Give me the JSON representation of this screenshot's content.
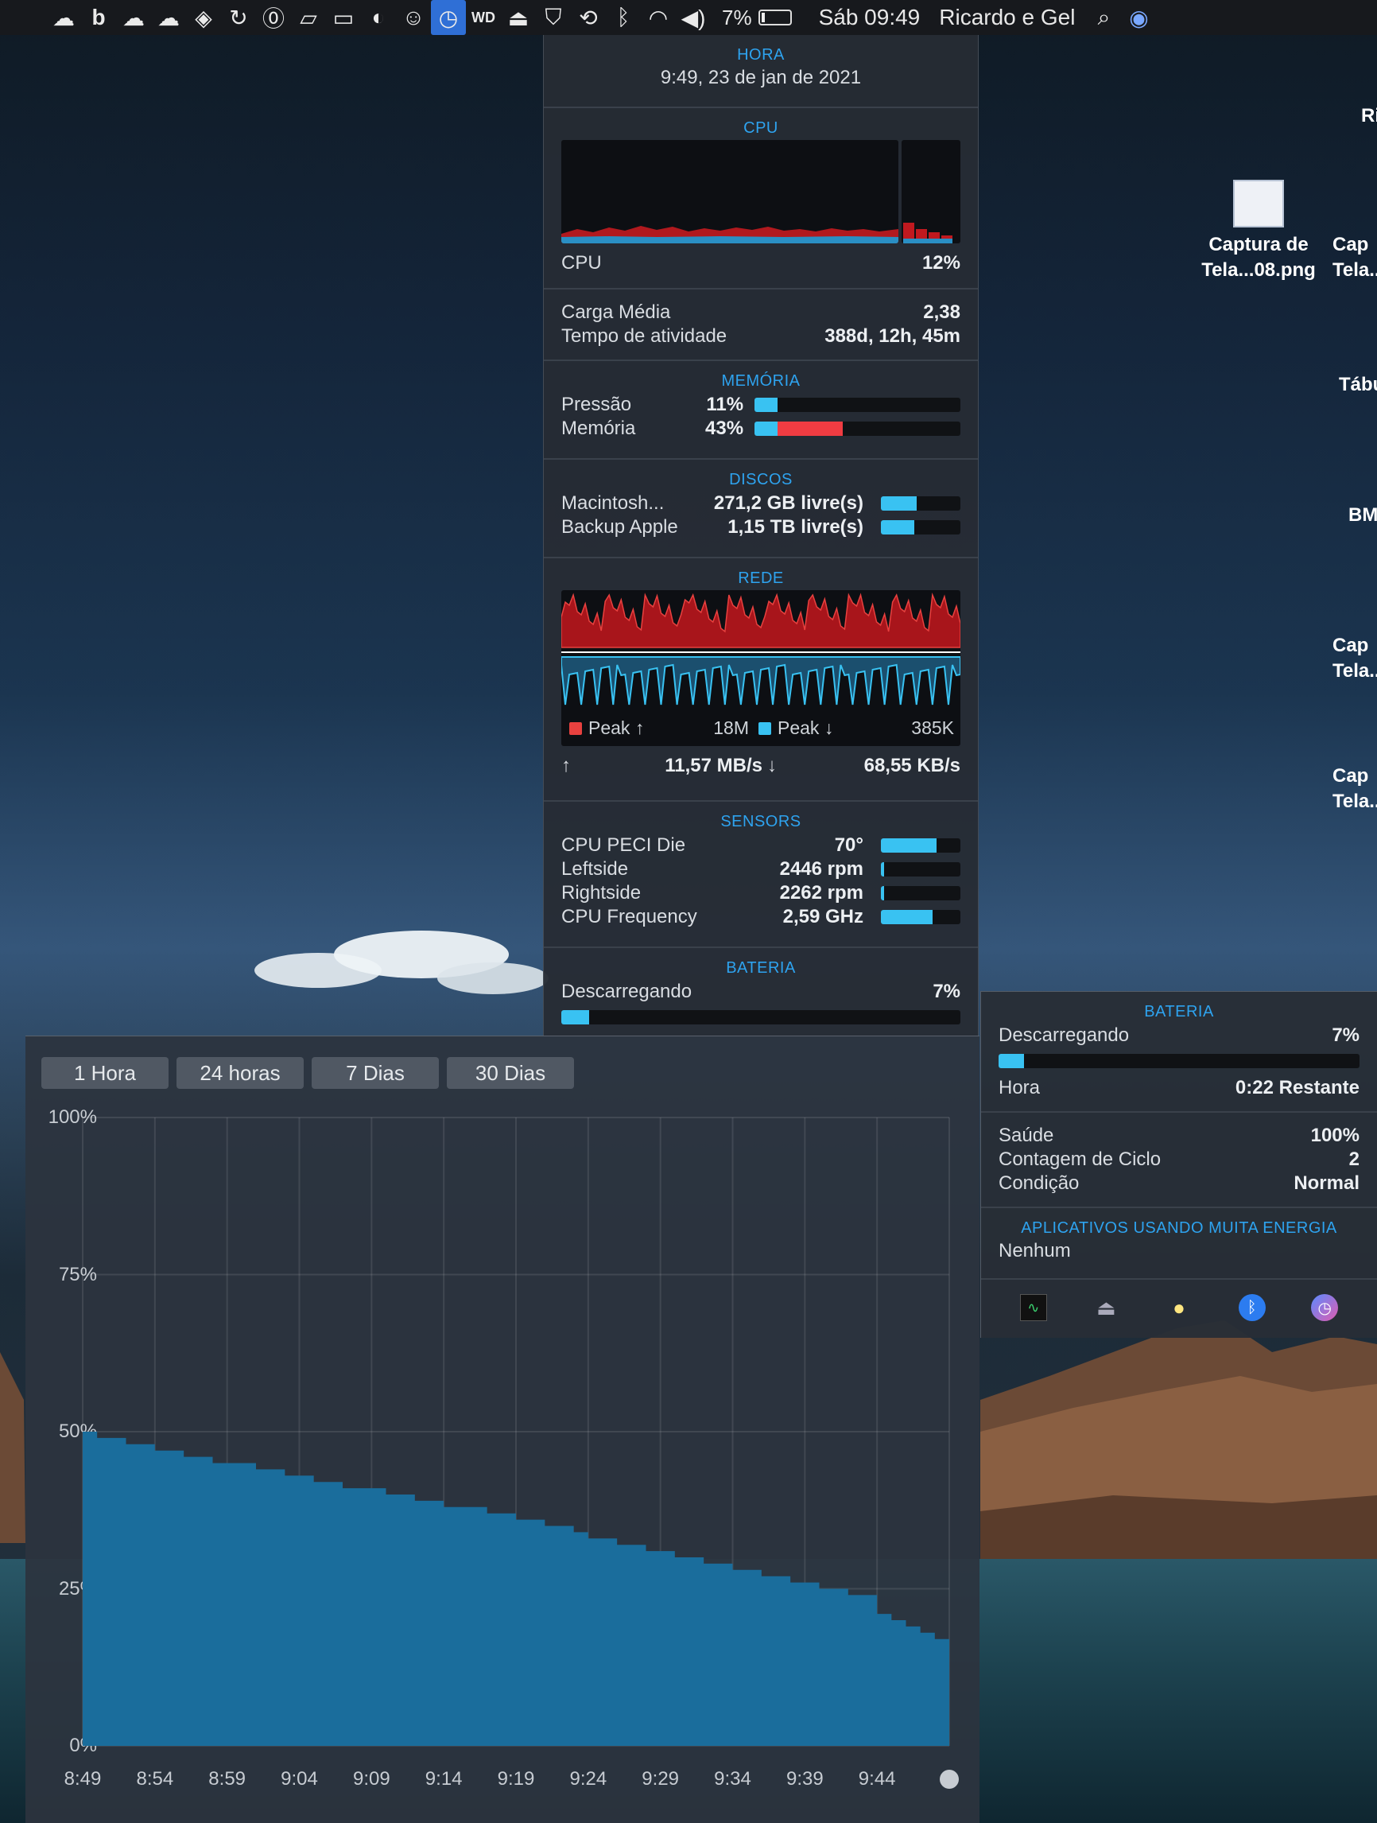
{
  "menubar": {
    "battery_percent": "7%",
    "clock": "Sáb 09:49",
    "user": "Ricardo e Gel",
    "icons": [
      "upload-cloud-icon",
      "b-icon",
      "cloud-icon",
      "cloud-icon",
      "ua-icon",
      "cc-icon",
      "one-password-icon",
      "notes-icon",
      "display-icon",
      "moon-icon",
      "ghost-icon",
      "istat-icon",
      "wd-icon",
      "airplay-icon",
      "shield-icon",
      "time-machine-icon",
      "bluetooth-icon",
      "wifi-icon",
      "volume-icon"
    ]
  },
  "desktop": {
    "items": [
      {
        "label_line1": "Ri",
        "label_line2": ""
      },
      {
        "label_line1": "Captura de",
        "label_line2": "Tela...08.png"
      },
      {
        "label_line1": "Cap",
        "label_line2": "Tela..."
      },
      {
        "label_line1": "Tábu",
        "label_line2": ""
      },
      {
        "label_line1": "BM",
        "label_line2": ""
      },
      {
        "label_line1": "Cap",
        "label_line2": "Tela..."
      },
      {
        "label_line1": "Cap",
        "label_line2": "Tela..."
      }
    ]
  },
  "popover": {
    "hora": {
      "title": "HORA",
      "datetime": "9:49, 23 de jan de 2021"
    },
    "cpu": {
      "title": "CPU",
      "label": "CPU",
      "value": "12%"
    },
    "load": {
      "carga_label": "Carga Média",
      "carga_value": "2,38",
      "uptime_label": "Tempo de atividade",
      "uptime_value": "388d, 12h, 45m"
    },
    "memoria": {
      "title": "MEMÓRIA",
      "rows": [
        {
          "label": "Pressão",
          "value": "11%",
          "fill": 0.11,
          "red": 0
        },
        {
          "label": "Memória",
          "value": "43%",
          "fill": 0.11,
          "red": 0.32
        }
      ]
    },
    "discos": {
      "title": "DISCOS",
      "rows": [
        {
          "label": "Macintosh...",
          "value": "271,2 GB livre(s)",
          "fill": 0.45
        },
        {
          "label": "Backup Apple",
          "value": "1,15 TB livre(s)",
          "fill": 0.42
        }
      ]
    },
    "rede": {
      "title": "REDE",
      "peak_up_label": "Peak ↑",
      "peak_up_value": "18M",
      "peak_down_label": "Peak ↓",
      "peak_down_value": "385K",
      "up_arrow": "↑",
      "up_value": "11,57 MB/s",
      "down_arrow": "↓",
      "down_value": "68,55 KB/s"
    },
    "sensors": {
      "title": "SENSORS",
      "rows": [
        {
          "label": "CPU PECI Die",
          "value": "70°",
          "fill": 0.7
        },
        {
          "label": "Leftside",
          "value": "2446 rpm",
          "fill": 0.04
        },
        {
          "label": "Rightside",
          "value": "2262 rpm",
          "fill": 0.04
        },
        {
          "label": "CPU Frequency",
          "value": "2,59 GHz",
          "fill": 0.65
        }
      ]
    },
    "bateria": {
      "title": "BATERIA",
      "label": "Descarregando",
      "value": "7%",
      "fill": 0.07
    }
  },
  "history": {
    "tabs": [
      "1 Hora",
      "24 horas",
      "7 Dias",
      "30 Dias"
    ],
    "selected_tab": 0
  },
  "battery_panel": {
    "title": "BATERIA",
    "status_label": "Descarregando",
    "status_value": "7%",
    "fill": 0.07,
    "time_label": "Hora",
    "time_value": "0:22 Restante",
    "health_label": "Saúde",
    "health_value": "100%",
    "cycle_label": "Contagem de Ciclo",
    "cycle_value": "2",
    "condition_label": "Condição",
    "condition_value": "Normal",
    "apps_title": "APLICATIVOS USANDO MUITA ENERGIA",
    "apps_value": "Nenhum",
    "footer_icons": [
      "activity-monitor-icon",
      "eject-icon",
      "lightbulb-icon",
      "bluetooth-icon",
      "istat-icon"
    ]
  },
  "chart_data": {
    "type": "area",
    "title": "",
    "xlabel": "",
    "ylabel": "",
    "ylim": [
      0,
      100
    ],
    "yticks": [
      "100%",
      "75%",
      "50%",
      "25%",
      "0%"
    ],
    "xticks": [
      "8:49",
      "8:54",
      "8:59",
      "9:04",
      "9:09",
      "9:14",
      "9:19",
      "9:24",
      "9:29",
      "9:34",
      "9:39",
      "9:44"
    ],
    "color": "#1a6d9c",
    "x": [
      0,
      1,
      2,
      3,
      4,
      5,
      6,
      7,
      8,
      9,
      10,
      11,
      12,
      13,
      14,
      15,
      16,
      17,
      18,
      19,
      20,
      21,
      22,
      23,
      24,
      25,
      26,
      27,
      28,
      29,
      30,
      31,
      32,
      33,
      34,
      35,
      36,
      37,
      38,
      39,
      40,
      41,
      42,
      43,
      44,
      45,
      46,
      47,
      48,
      49,
      50,
      51,
      52,
      53,
      54,
      55,
      56,
      57,
      58,
      59,
      60
    ],
    "values": [
      50,
      49,
      49,
      48,
      48,
      47,
      47,
      46,
      46,
      45,
      45,
      45,
      44,
      44,
      43,
      43,
      42,
      42,
      41,
      41,
      41,
      40,
      40,
      39,
      39,
      38,
      38,
      38,
      37,
      37,
      36,
      36,
      35,
      35,
      34,
      33,
      33,
      32,
      32,
      31,
      31,
      30,
      30,
      29,
      29,
      28,
      28,
      27,
      27,
      26,
      26,
      25,
      25,
      24,
      24,
      21,
      20,
      19,
      18,
      17,
      17
    ]
  }
}
